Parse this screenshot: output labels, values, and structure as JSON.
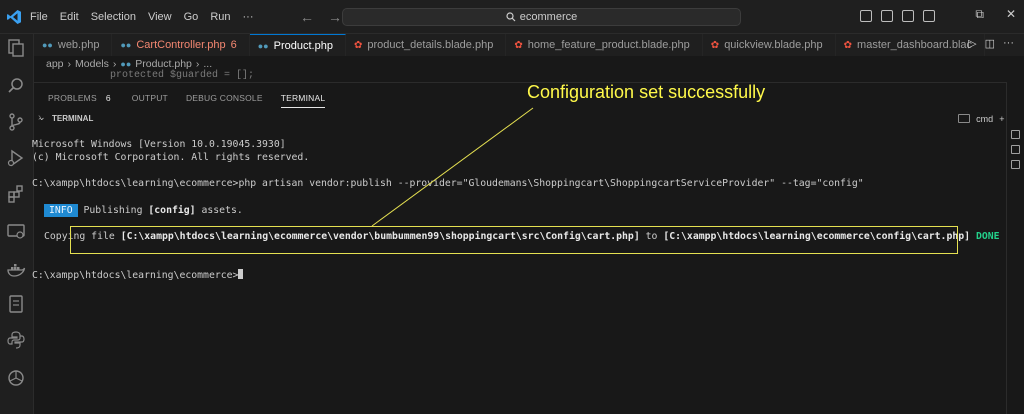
{
  "menu": [
    "File",
    "Edit",
    "Selection",
    "View",
    "Go",
    "Run",
    "···"
  ],
  "search": {
    "text": "ecommerce"
  },
  "tabs": [
    {
      "label": "web.php",
      "icon": "php",
      "active": false,
      "count": ""
    },
    {
      "label": "CartController.php",
      "icon": "php",
      "active": false,
      "count": "6",
      "error": true
    },
    {
      "label": "Product.php",
      "icon": "php",
      "active": true,
      "count": ""
    },
    {
      "label": "product_details.blade.php",
      "icon": "blade",
      "active": false,
      "count": ""
    },
    {
      "label": "home_feature_product.blade.php",
      "icon": "blade",
      "active": false,
      "count": ""
    },
    {
      "label": "quickview.blade.php",
      "icon": "blade",
      "active": false,
      "count": ""
    },
    {
      "label": "master_dashboard.blac",
      "icon": "blade",
      "active": false,
      "count": ""
    }
  ],
  "breadcrumb": {
    "app": "app",
    "models": "Models",
    "file": "Product.php",
    "more": "..."
  },
  "code_peek": "protected $guarded = [];",
  "panel": {
    "tabs": {
      "problems": "PROBLEMS",
      "problems_count": "6",
      "output": "OUTPUT",
      "debug": "DEBUG CONSOLE",
      "terminal": "TERMINAL"
    },
    "section": "TERMINAL",
    "shell": "cmd"
  },
  "terminal": {
    "line1": "Microsoft Windows [Version 10.0.19045.3930]",
    "line2": "(c) Microsoft Corporation. All rights reserved.",
    "cmd": "C:\\xampp\\htdocs\\learning\\ecommerce>php artisan vendor:publish --provider=\"Gloudemans\\Shoppingcart\\ShoppingcartServiceProvider\" --tag=\"config\"",
    "info_badge": "INFO",
    "info_pre": "Publishing",
    "info_bold": "[config]",
    "info_post": "assets.",
    "copy_pre": "Copying file",
    "copy_src": "[C:\\xampp\\htdocs\\learning\\ecommerce\\vendor\\bumbummen99\\shoppingcart\\src\\Config\\cart.php]",
    "copy_to": "to",
    "copy_dst": "[C:\\xampp\\htdocs\\learning\\ecommerce\\config\\cart.php]",
    "copy_done": "DONE",
    "prompt": "C:\\xampp\\htdocs\\learning\\ecommerce>"
  },
  "annotation": "Configuration set successfully",
  "colors": {
    "accent": "#0078d4",
    "annotation": "#fff94a",
    "info": "#1f8ad2",
    "done": "#23d18b",
    "error": "#f48771"
  }
}
